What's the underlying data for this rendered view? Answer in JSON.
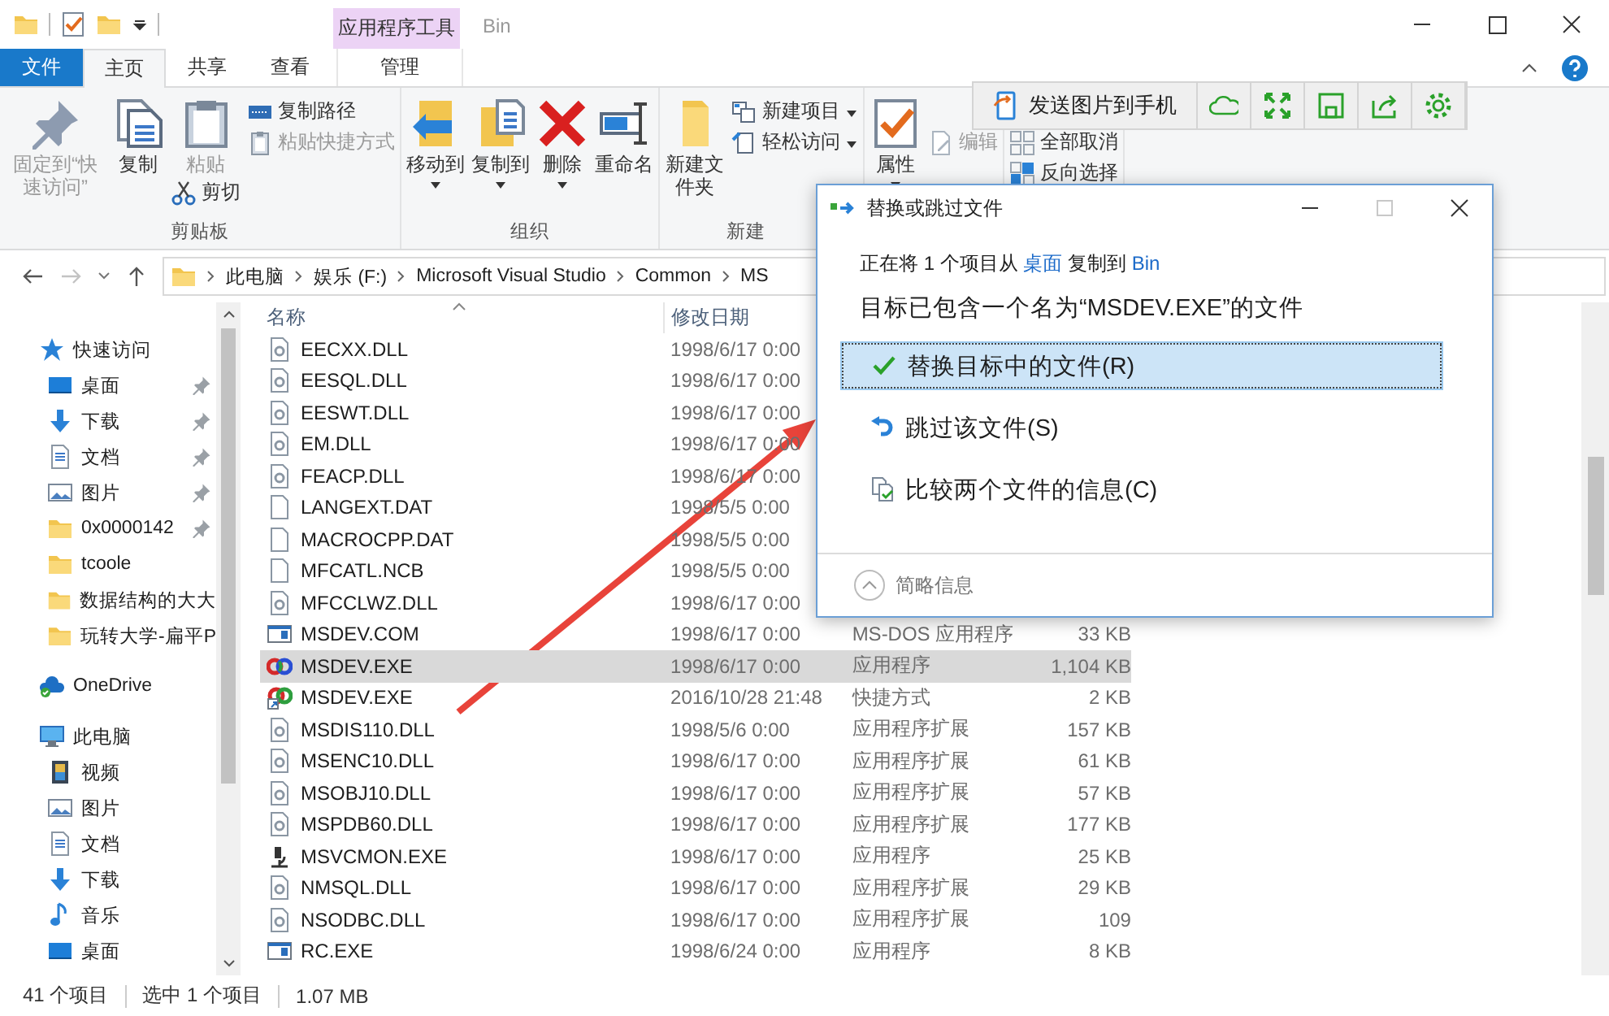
{
  "window": {
    "title": "Bin",
    "context_label": "应用程序工具"
  },
  "tabs": [
    {
      "label": "文件",
      "kind": "file",
      "selected": false
    },
    {
      "label": "主页",
      "kind": "normal",
      "selected": true
    },
    {
      "label": "共享",
      "kind": "normal",
      "selected": false
    },
    {
      "label": "查看",
      "kind": "normal",
      "selected": false
    },
    {
      "label": "管理",
      "kind": "context",
      "selected": false
    }
  ],
  "ribbon": {
    "groups": [
      {
        "label": "剪贴板",
        "columns": [
          [
            {
              "label": "固定到“快速访问”",
              "kind": "pin",
              "disabled": true,
              "dropdown": false
            }
          ],
          [
            {
              "label": "复制",
              "kind": "copy",
              "disabled": false,
              "dropdown": false
            }
          ],
          [
            {
              "label": "粘贴",
              "kind": "paste",
              "disabled": true,
              "dropdown": false
            },
            {
              "label": "剪切",
              "kind": "cut",
              "disabled": false,
              "dropdown": false
            }
          ],
          [
            {
              "label": "复制路径",
              "kind": "path",
              "disabled": false,
              "dropdown": false
            },
            {
              "label": "粘贴快捷方式",
              "kind": "paste-shortcut",
              "disabled": true,
              "dropdown": false
            }
          ]
        ]
      },
      {
        "label": "组织",
        "columns": [
          [
            {
              "label": "移动到",
              "kind": "move",
              "disabled": false,
              "dropdown": true
            }
          ],
          [
            {
              "label": "复制到",
              "kind": "copyto",
              "disabled": false,
              "dropdown": true
            }
          ],
          [
            {
              "label": "删除",
              "kind": "delete",
              "disabled": false,
              "dropdown": true
            }
          ],
          [
            {
              "label": "重命名",
              "kind": "rename",
              "disabled": false,
              "dropdown": false
            }
          ]
        ]
      },
      {
        "label": "新建",
        "columns": [
          [
            {
              "label": "新建文件夹",
              "kind": "newfolder",
              "disabled": false,
              "dropdown": false
            }
          ],
          [
            {
              "label": "新建项目",
              "kind": "newitem",
              "disabled": false,
              "dropdown": true
            },
            {
              "label": "轻松访问",
              "kind": "easy",
              "disabled": false,
              "dropdown": true
            }
          ]
        ]
      },
      {
        "columns": [
          [
            {
              "label": "属性",
              "kind": "properties",
              "disabled": false,
              "dropdown": true
            }
          ],
          [
            null,
            {
              "label": "编辑",
              "kind": "edit",
              "disabled": true,
              "dropdown": false
            }
          ]
        ]
      },
      {
        "columns": [
          [
            null,
            {
              "label": "全部取消",
              "kind": "selnone",
              "disabled": false,
              "dropdown": false
            },
            {
              "label": "反向选择",
              "kind": "invert",
              "disabled": false,
              "dropdown": false
            }
          ]
        ]
      }
    ]
  },
  "phone_toolbar": {
    "send_label": "发送图片到手机"
  },
  "address": {
    "path": [
      "此电脑",
      "娱乐 (F:)",
      "Microsoft Visual Studio",
      "Common",
      "MS"
    ]
  },
  "navigation": {
    "items": [
      {
        "label": "快速访问",
        "kind": "star",
        "children": [
          {
            "label": "桌面",
            "kind": "desktop",
            "pinned": true
          },
          {
            "label": "下载",
            "kind": "download",
            "pinned": true
          },
          {
            "label": "文档",
            "kind": "document",
            "pinned": true
          },
          {
            "label": "图片",
            "kind": "picture",
            "pinned": true
          },
          {
            "label": "0x0000142",
            "kind": "folder",
            "pinned": true
          },
          {
            "label": "tcoole",
            "kind": "folder",
            "pinned": false
          },
          {
            "label": "数据结构的大大",
            "kind": "folder",
            "pinned": false
          },
          {
            "label": "玩转大学-扁平P",
            "kind": "folder",
            "pinned": false
          }
        ]
      },
      {
        "label": "OneDrive",
        "kind": "onedrive"
      },
      {
        "label": "此电脑",
        "kind": "computer",
        "children": [
          {
            "label": "视频",
            "kind": "video",
            "pinned": false
          },
          {
            "label": "图片",
            "kind": "picture",
            "pinned": false
          },
          {
            "label": "文档",
            "kind": "document",
            "pinned": false
          },
          {
            "label": "下载",
            "kind": "download",
            "pinned": false
          },
          {
            "label": "音乐",
            "kind": "music",
            "pinned": false
          },
          {
            "label": "桌面",
            "kind": "desktop",
            "pinned": false
          }
        ]
      }
    ]
  },
  "table": {
    "columns": [
      {
        "label": "名称",
        "sorted": true
      },
      {
        "label": "修改日期",
        "sorted": false
      }
    ],
    "rows": [
      {
        "name": "EECXX.DLL",
        "kind": "dll",
        "date": "1998/6/17 0:00",
        "selected": false
      },
      {
        "name": "EESQL.DLL",
        "kind": "dll",
        "date": "1998/6/17 0:00",
        "selected": false
      },
      {
        "name": "EESWT.DLL",
        "kind": "dll",
        "date": "1998/6/17 0:00",
        "selected": false
      },
      {
        "name": "EM.DLL",
        "kind": "dll",
        "date": "1998/6/17 0:00",
        "selected": false
      },
      {
        "name": "FEACP.DLL",
        "kind": "dll",
        "date": "1998/6/17 0:00",
        "selected": false
      },
      {
        "name": "LANGEXT.DAT",
        "kind": "file",
        "date": "1998/5/5 0:00",
        "selected": false
      },
      {
        "name": "MACROCPP.DAT",
        "kind": "file",
        "date": "1998/5/5 0:00",
        "selected": false
      },
      {
        "name": "MFCATL.NCB",
        "kind": "file",
        "date": "1998/5/5 0:00",
        "selected": false
      },
      {
        "name": "MFCCLWZ.DLL",
        "kind": "dll",
        "date": "1998/6/17 0:00",
        "selected": false
      },
      {
        "name": "MSDEV.COM",
        "kind": "window",
        "date": "1998/6/17 0:00",
        "type": "MS-DOS 应用程序",
        "size": "33 KB",
        "selected": false
      },
      {
        "name": "MSDEV.EXE",
        "kind": "app",
        "date": "1998/6/17 0:00",
        "type": "应用程序",
        "size": "1,104 KB",
        "selected": true
      },
      {
        "name": "MSDEV.EXE",
        "kind": "shortcut",
        "date": "2016/10/28 21:48",
        "type": "快捷方式",
        "size": "2 KB",
        "selected": false
      },
      {
        "name": "MSDIS110.DLL",
        "kind": "dll",
        "date": "1998/5/6 0:00",
        "type": "应用程序扩展",
        "size": "157 KB",
        "selected": false
      },
      {
        "name": "MSENC10.DLL",
        "kind": "dll",
        "date": "1998/6/17 0:00",
        "type": "应用程序扩展",
        "size": "61 KB",
        "selected": false
      },
      {
        "name": "MSOBJ10.DLL",
        "kind": "dll",
        "date": "1998/6/17 0:00",
        "type": "应用程序扩展",
        "size": "57 KB",
        "selected": false
      },
      {
        "name": "MSPDB60.DLL",
        "kind": "dll",
        "date": "1998/6/17 0:00",
        "type": "应用程序扩展",
        "size": "177 KB",
        "selected": false
      },
      {
        "name": "MSVCMON.EXE",
        "kind": "tool",
        "date": "1998/6/17 0:00",
        "type": "应用程序",
        "size": "25 KB",
        "selected": false
      },
      {
        "name": "NMSQL.DLL",
        "kind": "dll",
        "date": "1998/6/17 0:00",
        "type": "应用程序扩展",
        "size": "29 KB",
        "selected": false
      },
      {
        "name": "NSODBC.DLL",
        "kind": "dll",
        "date": "1998/6/17 0:00",
        "type": "应用程序扩展",
        "size": "109",
        "selected": false
      },
      {
        "name": "RC.EXE",
        "kind": "window",
        "date": "1998/6/24 0:00",
        "type": "应用程序",
        "size": "8 KB",
        "selected": false
      }
    ]
  },
  "status_bar": {
    "items": [
      "41 个项目",
      "选中 1 个项目",
      "1.07 MB"
    ]
  },
  "dialog": {
    "title": "替换或跳过文件",
    "message_parts": [
      {
        "text": "正在将 1 个项目从",
        "kind": "text"
      },
      {
        "text": "桌面",
        "kind": "link"
      },
      {
        "text": "复制到",
        "kind": "text"
      },
      {
        "text": "Bin",
        "kind": "link"
      }
    ],
    "heading": "目标已包含一个名为“MSDEV.EXE”的文件",
    "options": [
      {
        "label": "替换目标中的文件(R)",
        "kind": "check",
        "selected": true
      },
      {
        "label": "跳过该文件(S)",
        "kind": "skip",
        "selected": false
      },
      {
        "label": "比较两个文件的信息(C)",
        "kind": "compare",
        "selected": false
      }
    ],
    "details_toggle": "简略信息"
  }
}
